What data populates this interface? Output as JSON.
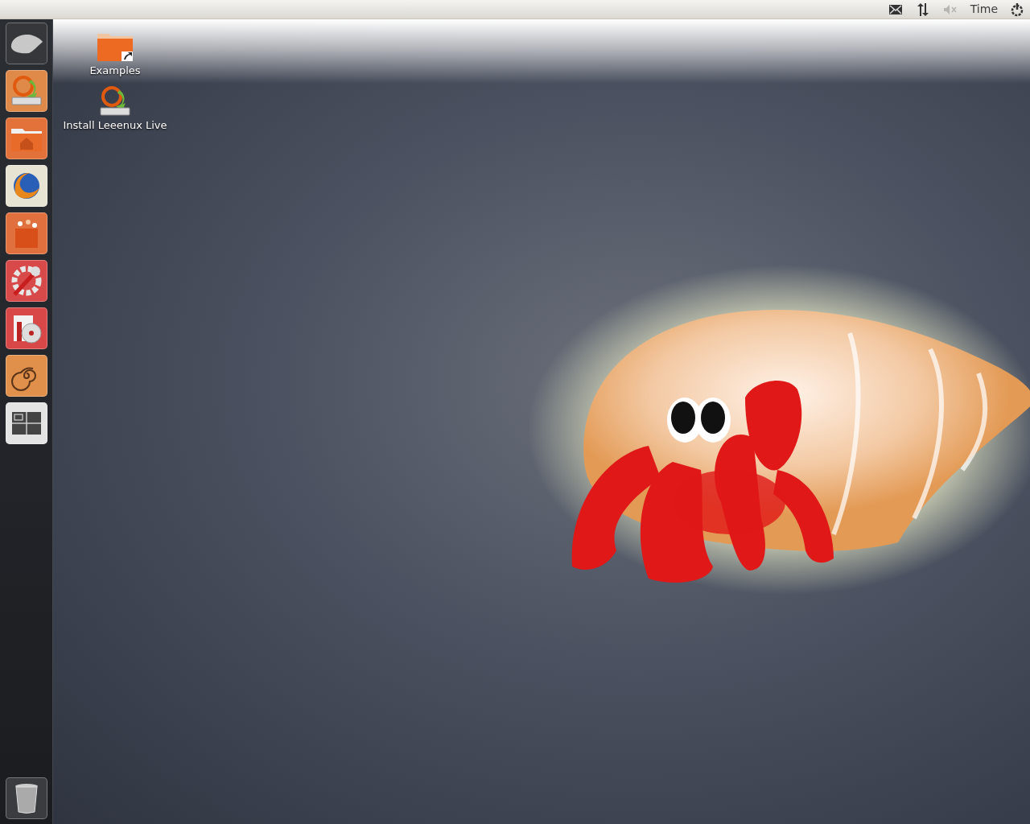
{
  "top_bar": {
    "indicators": [
      {
        "kind": "mail"
      },
      {
        "kind": "network"
      },
      {
        "kind": "sound",
        "muted": true
      },
      {
        "kind": "clock",
        "label": "Time"
      },
      {
        "kind": "session"
      }
    ]
  },
  "launcher": {
    "items": [
      {
        "kind": "dash"
      },
      {
        "kind": "installer"
      },
      {
        "kind": "home-folder"
      },
      {
        "kind": "browser"
      },
      {
        "kind": "software-center"
      },
      {
        "kind": "settings"
      },
      {
        "kind": "disc-burner"
      },
      {
        "kind": "shell"
      },
      {
        "kind": "workspaces"
      }
    ],
    "trash": {
      "kind": "trash"
    }
  },
  "desktop": {
    "icons": [
      {
        "kind": "folder-link",
        "label": "Examples"
      },
      {
        "kind": "installer",
        "label": "Install Leeenux Live"
      }
    ]
  }
}
